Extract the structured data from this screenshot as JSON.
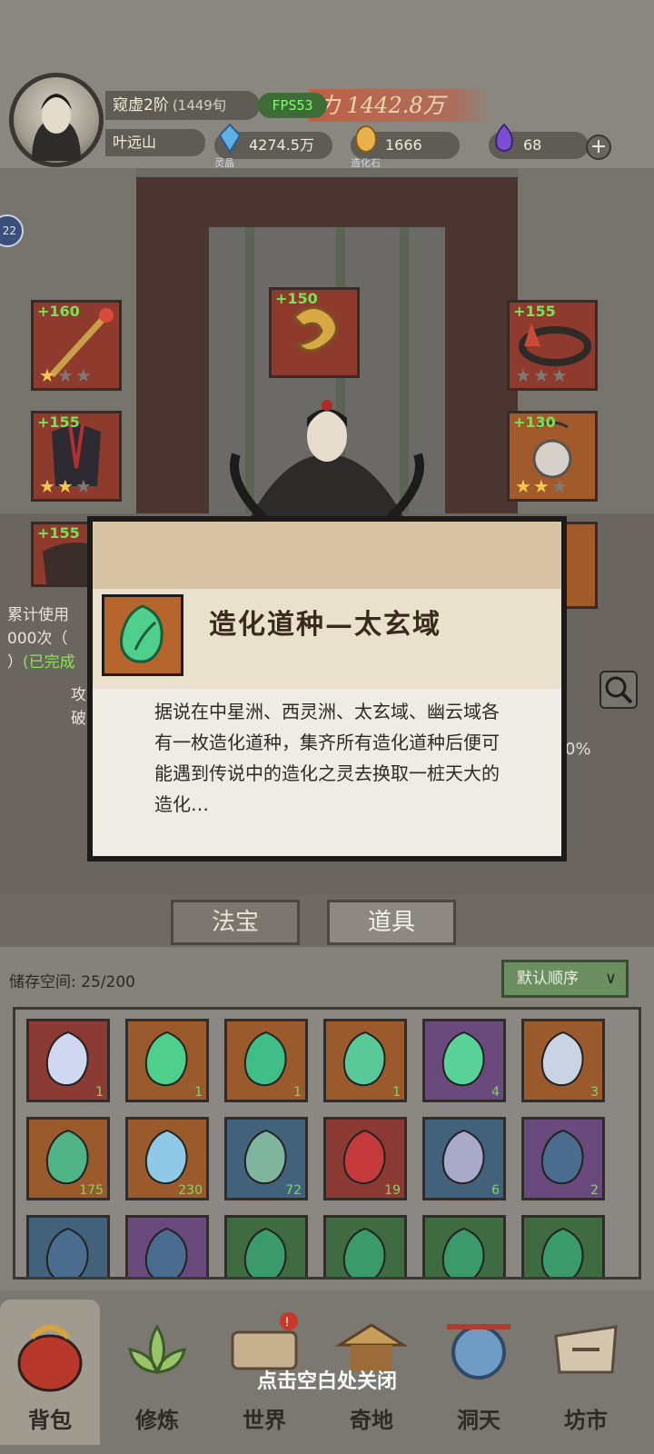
{
  "player": {
    "realm": "窥虚2阶",
    "realm_sub": "(1449旬",
    "name": "叶远山",
    "power_label": "力",
    "power_value": "1442.8万",
    "fps": "FPS53"
  },
  "resources": [
    {
      "icon": "spirit-crystal-icon",
      "label": "灵晶",
      "value": "4274.5万"
    },
    {
      "icon": "creation-stone-icon",
      "label": "造化石",
      "value": "1666"
    },
    {
      "icon": "purple-flame-icon",
      "label": "",
      "value": "68"
    }
  ],
  "side_badge": "22",
  "equipment": {
    "left": [
      {
        "level": "+160",
        "stars": 1,
        "icon": "staff-icon"
      },
      {
        "level": "+155",
        "stars": 2,
        "icon": "robe-icon"
      },
      {
        "level": "+155",
        "stars": 0,
        "icon": "armor-icon"
      }
    ],
    "center": {
      "level": "+150",
      "icon": "dragon-ornament-icon"
    },
    "right": [
      {
        "level": "+155",
        "stars": 0,
        "icon": "crown-icon"
      },
      {
        "level": "+130",
        "stars": 2,
        "icon": "pendant-icon"
      },
      {
        "level": "",
        "stars": 0,
        "icon": "ring-icon"
      }
    ]
  },
  "side_info": {
    "line1": "累计使用",
    "line2": "000次（",
    "line3": "）",
    "done": "(已完成",
    "stat1": "攻",
    "stat2": "破",
    "pct": "0%"
  },
  "tabs": [
    {
      "label": "法宝",
      "active": false
    },
    {
      "label": "道具",
      "active": true
    }
  ],
  "storage": {
    "label": "储存空间:",
    "value": "25/200",
    "sort_label": "默认顺序"
  },
  "inventory": [
    {
      "icon": "pearl-orb-icon",
      "count": "1",
      "bg": "red"
    },
    {
      "icon": "green-seed-icon",
      "count": "1",
      "bg": "orange"
    },
    {
      "icon": "green-swirl-icon",
      "count": "1",
      "bg": "orange"
    },
    {
      "icon": "jade-gourd-icon",
      "count": "1",
      "bg": "orange"
    },
    {
      "icon": "green-crystal-icon",
      "count": "4",
      "bg": "purple"
    },
    {
      "icon": "silver-crystal-icon",
      "count": "3",
      "bg": "orange"
    },
    {
      "icon": "green-wave-icon",
      "count": "175",
      "bg": "orange"
    },
    {
      "icon": "blue-crystal-icon",
      "count": "230",
      "bg": "orange"
    },
    {
      "icon": "jade-disc-icon",
      "count": "72",
      "bg": "blue"
    },
    {
      "icon": "red-scroll-icon",
      "count": "19",
      "bg": "red"
    },
    {
      "icon": "silver-talisman-icon",
      "count": "6",
      "bg": "blue"
    },
    {
      "icon": "treasure-chest-icon",
      "count": "2",
      "bg": "purple"
    },
    {
      "icon": "treasure-chest-icon",
      "count": "",
      "bg": "blue"
    },
    {
      "icon": "treasure-chest-icon",
      "count": "",
      "bg": "purple"
    },
    {
      "icon": "green-token-icon",
      "count": "",
      "bg": "green"
    },
    {
      "icon": "green-token-icon",
      "count": "",
      "bg": "green"
    },
    {
      "icon": "green-token-icon",
      "count": "",
      "bg": "green"
    },
    {
      "icon": "green-token-icon",
      "count": "",
      "bg": "green"
    }
  ],
  "nav": [
    {
      "label": "背包",
      "icon": "bag-icon",
      "active": true
    },
    {
      "label": "修炼",
      "icon": "lotus-icon",
      "active": false
    },
    {
      "label": "世界",
      "icon": "world-scroll-icon",
      "active": false
    },
    {
      "label": "奇地",
      "icon": "pavilion-icon",
      "active": false
    },
    {
      "label": "洞天",
      "icon": "portal-icon",
      "active": false
    },
    {
      "label": "坊市",
      "icon": "market-icon",
      "active": false
    }
  ],
  "close_hint": "点击空白处关闭",
  "dialog": {
    "title": "造化道种—太玄域",
    "icon": "green-seed-icon",
    "desc": "据说在中星洲、西灵洲、太玄域、幽云域各有一枚造化道种，集齐所有造化道种后便可能遇到传说中的造化之灵去换取一桩天大的造化…"
  },
  "colors": {
    "fps_text": "#7cff6a",
    "count_green": "#7cd869",
    "level_green": "#77e255",
    "star_gold": "#f1c84e"
  }
}
